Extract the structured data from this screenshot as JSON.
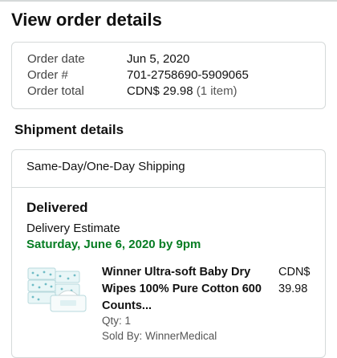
{
  "page": {
    "title": "View order details"
  },
  "order_summary": {
    "rows": [
      {
        "label": "Order date",
        "value": "Jun 5, 2020",
        "extra": ""
      },
      {
        "label": "Order #",
        "value": "701-2758690-5909065",
        "extra": ""
      },
      {
        "label": "Order total",
        "value": "CDN$ 29.98",
        "extra": "(1 item)"
      }
    ]
  },
  "shipment": {
    "section_title": "Shipment details",
    "shipping_type": "Same-Day/One-Day Shipping",
    "status": "Delivered",
    "estimate_label": "Delivery Estimate",
    "estimate_date": "Saturday, June 6, 2020 by 9pm",
    "estimate_color": "#067d23",
    "item": {
      "title": "Winner Ultra-soft Baby Dry Wipes 100% Pure Cotton 600 Counts...",
      "price_currency": "CDN$",
      "price_value": "39.98",
      "qty": "Qty: 1",
      "sold_by": "Sold By: WinnerMedical"
    }
  }
}
